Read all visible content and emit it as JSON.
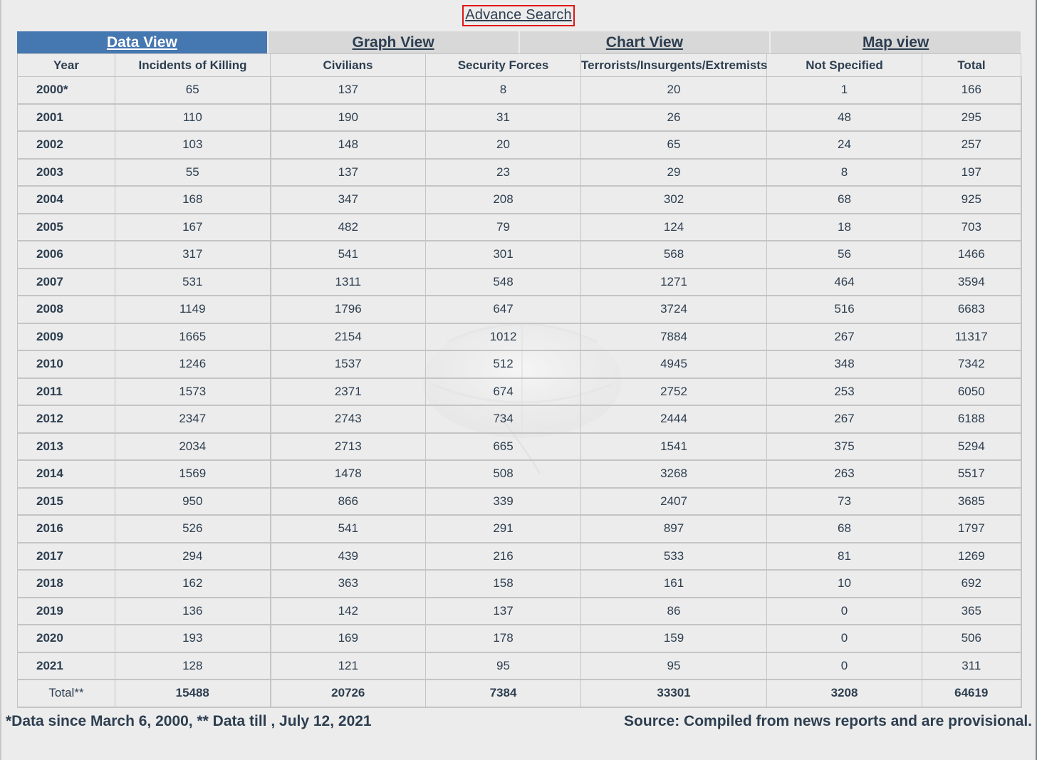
{
  "advance_search": "Advance Search",
  "tabs": [
    "Data View",
    "Graph View",
    "Chart View",
    "Map view"
  ],
  "active_tab": "Data View",
  "columns": [
    "Year",
    "Incidents of Killing",
    "Civilians",
    "Security Forces",
    "Terrorists/Insurgents/Extremists",
    "Not Specified",
    "Total"
  ],
  "rows": [
    [
      "2000*",
      "65",
      "137",
      "8",
      "20",
      "1",
      "166"
    ],
    [
      "2001",
      "110",
      "190",
      "31",
      "26",
      "48",
      "295"
    ],
    [
      "2002",
      "103",
      "148",
      "20",
      "65",
      "24",
      "257"
    ],
    [
      "2003",
      "55",
      "137",
      "23",
      "29",
      "8",
      "197"
    ],
    [
      "2004",
      "168",
      "347",
      "208",
      "302",
      "68",
      "925"
    ],
    [
      "2005",
      "167",
      "482",
      "79",
      "124",
      "18",
      "703"
    ],
    [
      "2006",
      "317",
      "541",
      "301",
      "568",
      "56",
      "1466"
    ],
    [
      "2007",
      "531",
      "1311",
      "548",
      "1271",
      "464",
      "3594"
    ],
    [
      "2008",
      "1149",
      "1796",
      "647",
      "3724",
      "516",
      "6683"
    ],
    [
      "2009",
      "1665",
      "2154",
      "1012",
      "7884",
      "267",
      "11317"
    ],
    [
      "2010",
      "1246",
      "1537",
      "512",
      "4945",
      "348",
      "7342"
    ],
    [
      "2011",
      "1573",
      "2371",
      "674",
      "2752",
      "253",
      "6050"
    ],
    [
      "2012",
      "2347",
      "2743",
      "734",
      "2444",
      "267",
      "6188"
    ],
    [
      "2013",
      "2034",
      "2713",
      "665",
      "1541",
      "375",
      "5294"
    ],
    [
      "2014",
      "1569",
      "1478",
      "508",
      "3268",
      "263",
      "5517"
    ],
    [
      "2015",
      "950",
      "866",
      "339",
      "2407",
      "73",
      "3685"
    ],
    [
      "2016",
      "526",
      "541",
      "291",
      "897",
      "68",
      "1797"
    ],
    [
      "2017",
      "294",
      "439",
      "216",
      "533",
      "81",
      "1269"
    ],
    [
      "2018",
      "162",
      "363",
      "158",
      "161",
      "10",
      "692"
    ],
    [
      "2019",
      "136",
      "142",
      "137",
      "86",
      "0",
      "365"
    ],
    [
      "2020",
      "193",
      "169",
      "178",
      "159",
      "0",
      "506"
    ],
    [
      "2021",
      "128",
      "121",
      "95",
      "95",
      "0",
      "311"
    ]
  ],
  "total_row": [
    "Total**",
    "15488",
    "20726",
    "7384",
    "33301",
    "3208",
    "64619"
  ],
  "footer": {
    "note": "*Data since March 6, 2000, ** Data till , July 12, 2021",
    "source": "Source: Compiled from news reports and are provisional."
  },
  "colors": {
    "active_tab_bg": "#4577b1",
    "tab_bg": "#d8d8d8",
    "page_bg": "#ececec",
    "text": "#2d3e50",
    "advance_border": "#e01616"
  }
}
